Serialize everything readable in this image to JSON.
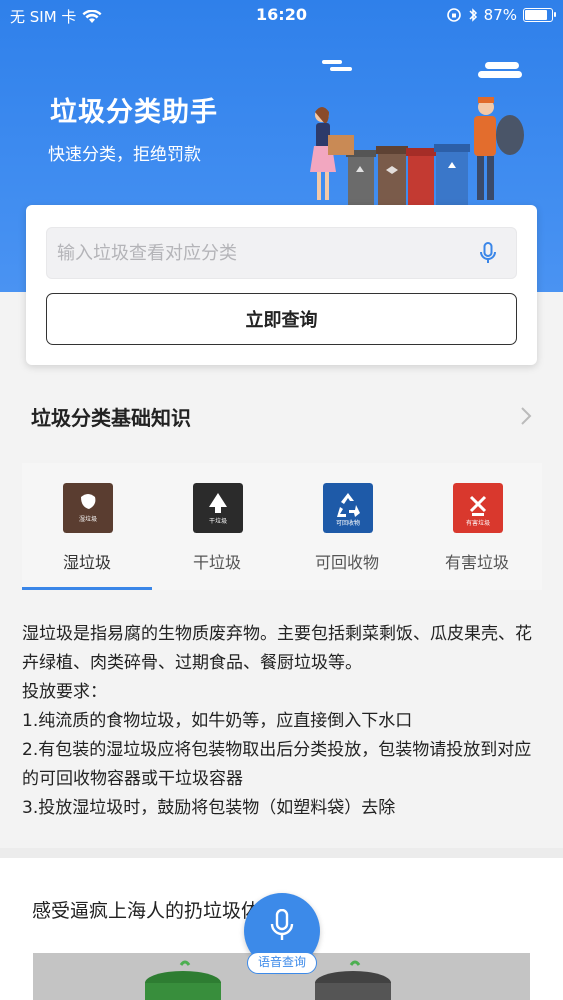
{
  "status_bar": {
    "carrier": "无 SIM 卡",
    "time": "16:20",
    "battery": "87%",
    "battery_level": 0.87,
    "icons": [
      "wifi-icon",
      "orientation-lock-icon",
      "bluetooth-icon",
      "battery-icon"
    ]
  },
  "header": {
    "title": "垃圾分类助手",
    "subtitle": "快速分类，拒绝罚款",
    "background_color": "#3a86e8"
  },
  "search": {
    "placeholder": "输入垃圾查看对应分类",
    "value": "",
    "button_label": "立即查询"
  },
  "knowledge": {
    "title": "垃圾分类基础知识",
    "tabs": [
      {
        "label": "湿垃圾",
        "icon": "wet-waste-icon",
        "color": "#5a3d30",
        "selected": true
      },
      {
        "label": "干垃圾",
        "icon": "dry-waste-icon",
        "color": "#2b2b2b",
        "selected": false
      },
      {
        "label": "可回收物",
        "icon": "recyclable-icon",
        "color": "#1e5aa8",
        "selected": false
      },
      {
        "label": "有害垃圾",
        "icon": "hazardous-waste-icon",
        "color": "#d9382d",
        "selected": false
      }
    ],
    "description": [
      "湿垃圾是指易腐的生物质废弃物。主要包括剩菜剩饭、瓜皮果壳、花卉绿植、肉类碎骨、过期食品、餐厨垃圾等。",
      "投放要求：",
      "1.纯流质的食物垃圾，如牛奶等，应直接倒入下水口",
      "2.有包装的湿垃圾应将包装物取出后分类投放，包装物请投放到对应的可回收物容器或干垃圾容器",
      "3.投放湿垃圾时，鼓励将包装物（如塑料袋）去除"
    ]
  },
  "promo": {
    "title": "感受逼疯上海人的扔垃圾体验!"
  },
  "voice_button": {
    "label": "语音查询"
  },
  "colors": {
    "accent": "#3a86e8"
  }
}
